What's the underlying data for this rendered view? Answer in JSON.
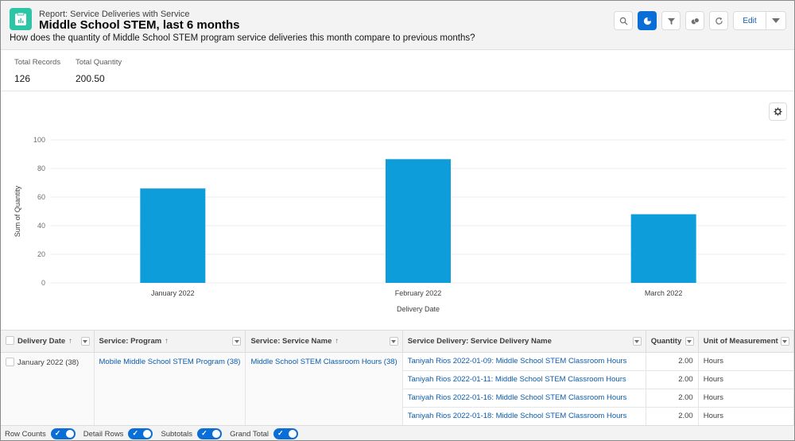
{
  "header": {
    "eyebrow": "Report: Service Deliveries with Service",
    "title": "Middle School STEM, last 6 months",
    "description": "How does the quantity of Middle School STEM program service deliveries this month compare to previous months?",
    "app_icon": "report-icon",
    "toolbar": [
      {
        "name": "search",
        "icon": "search-icon",
        "active": false
      },
      {
        "name": "chart",
        "icon": "chart-icon",
        "active": true
      },
      {
        "name": "filter",
        "icon": "filter-icon",
        "active": false
      },
      {
        "name": "conditional-formatting",
        "icon": "formatting-icon",
        "active": false
      },
      {
        "name": "refresh",
        "icon": "refresh-icon",
        "active": false
      }
    ],
    "edit_label": "Edit"
  },
  "summary": {
    "total_records_label": "Total Records",
    "total_records_value": "126",
    "total_quantity_label": "Total Quantity",
    "total_quantity_value": "200.50"
  },
  "colors": {
    "accent": "#0b6ed6",
    "bar": "#0d9dda",
    "app_icon": "#2ec4a6",
    "link": "#0b5cab"
  },
  "chart_data": {
    "type": "bar",
    "title": "",
    "categories": [
      "January 2022",
      "February 2022",
      "March 2022"
    ],
    "values": [
      66,
      86.5,
      48
    ],
    "xlabel": "Delivery Date",
    "ylabel": "Sum of Quantity",
    "ylim": [
      0,
      100
    ],
    "yticks": [
      0,
      20,
      40,
      60,
      80,
      100
    ],
    "grid": true,
    "legend": "none"
  },
  "table": {
    "columns": [
      {
        "label": "Delivery Date",
        "sort": "↑"
      },
      {
        "label": "Service: Program",
        "sort": "↑"
      },
      {
        "label": "Service: Service Name",
        "sort": "↑"
      },
      {
        "label": "Service Delivery: Service Delivery Name",
        "sort": ""
      },
      {
        "label": "Quantity",
        "sort": ""
      },
      {
        "label": "Unit of Measurement",
        "sort": ""
      }
    ],
    "group": {
      "delivery_date": "January 2022 (38)",
      "program": "Mobile Middle School STEM Program (38)",
      "service_name": "Middle School STEM Classroom Hours (38)"
    },
    "rows": [
      {
        "name": "Taniyah Rios 2022-01-09: Middle School STEM Classroom Hours",
        "quantity": "2.00",
        "unit": "Hours"
      },
      {
        "name": "Taniyah Rios 2022-01-11: Middle School STEM Classroom Hours",
        "quantity": "2.00",
        "unit": "Hours"
      },
      {
        "name": "Taniyah Rios 2022-01-16: Middle School STEM Classroom Hours",
        "quantity": "2.00",
        "unit": "Hours"
      },
      {
        "name": "Taniyah Rios 2022-01-18: Middle School STEM Classroom Hours",
        "quantity": "2.00",
        "unit": "Hours"
      }
    ]
  },
  "footer": {
    "toggles": [
      {
        "label": "Row Counts",
        "on": true
      },
      {
        "label": "Detail Rows",
        "on": true
      },
      {
        "label": "Subtotals",
        "on": true
      },
      {
        "label": "Grand Total",
        "on": true
      }
    ]
  }
}
